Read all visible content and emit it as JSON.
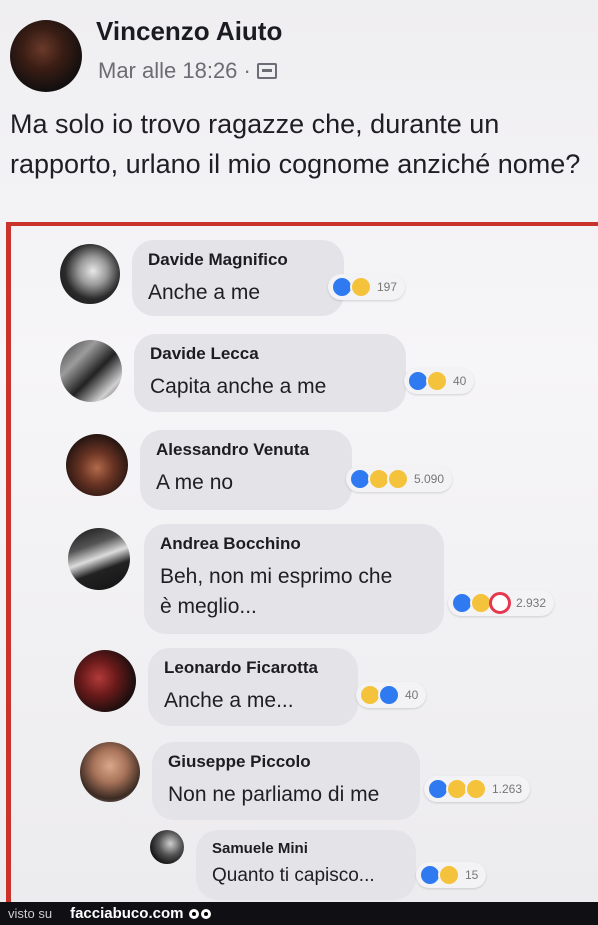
{
  "post": {
    "author": "Vincenzo Aiuto",
    "time": "Mar alle 18:26 ·",
    "privacy_icon": "public-icon",
    "text": "Ma solo io trovo ragazze che, durante un rapporto, urlano il mio cognome anziché nome?"
  },
  "comments": [
    {
      "name": "Davide Magnifico",
      "text": "Anche a me",
      "text2": "",
      "reactions": [
        "like",
        "haha"
      ],
      "count": "197"
    },
    {
      "name": "Davide Lecca",
      "text": "Capita anche a me",
      "text2": "",
      "reactions": [
        "like",
        "haha"
      ],
      "count": "40"
    },
    {
      "name": "Alessandro Venuta",
      "text": "A me no",
      "text2": "",
      "reactions": [
        "like",
        "haha",
        "sad"
      ],
      "count": "5.090"
    },
    {
      "name": "Andrea Bocchino",
      "text": "Beh, non mi esprimo che",
      "text2": "è meglio...",
      "reactions": [
        "like",
        "haha",
        "love"
      ],
      "count": "2.932"
    },
    {
      "name": "Leonardo Ficarotta",
      "text": "Anche a me...",
      "text2": "",
      "reactions": [
        "haha",
        "like"
      ],
      "count": "40"
    },
    {
      "name": "Giuseppe Piccolo",
      "text": "Non ne parliamo di me",
      "text2": "",
      "reactions": [
        "like",
        "haha",
        "sad"
      ],
      "count": "1.263"
    },
    {
      "name": "Samuele Mini",
      "text": "Quanto ti capisco...",
      "text2": "",
      "reactions": [
        "like",
        "haha"
      ],
      "count": "15"
    }
  ],
  "footer": {
    "prefix": "visto su",
    "brand": "facciabuco.com"
  },
  "colors": {
    "frame": "#c9332b",
    "like": "#2f7af1",
    "haha": "#f5c33b",
    "love": "#e63950"
  }
}
